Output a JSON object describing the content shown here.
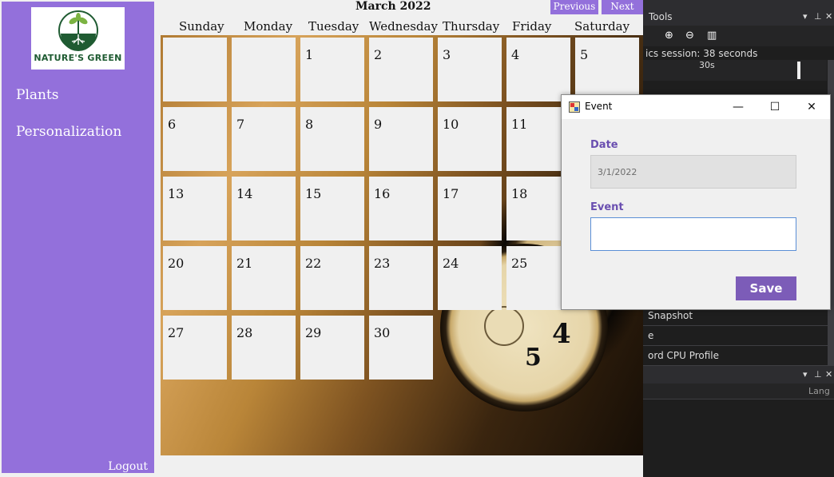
{
  "sidebar": {
    "logo_text": "NATURE'S GREEN",
    "nav_items": [
      {
        "label": "Plants"
      },
      {
        "label": "Personalization"
      }
    ],
    "logout_label": "Logout",
    "accent_color": "#9370db"
  },
  "calendar": {
    "month_title": "March 2022",
    "previous_label": "Previous",
    "next_label": "Next",
    "day_names": [
      "Sunday",
      "Monday",
      "Tuesday",
      "Wednesday",
      "Thursday",
      "Friday",
      "Saturday"
    ],
    "days": [
      "1",
      "2",
      "3",
      "4",
      "5",
      "6",
      "7",
      "8",
      "9",
      "10",
      "11",
      "13",
      "14",
      "15",
      "16",
      "17",
      "18",
      "20",
      "21",
      "22",
      "23",
      "24",
      "25",
      "27",
      "28",
      "29",
      "30"
    ],
    "clock_numbers": [
      "4",
      "5"
    ]
  },
  "dialog": {
    "title": "Event",
    "minimize_glyph": "—",
    "maximize_glyph": "☐",
    "close_glyph": "✕",
    "date_label": "Date",
    "date_value": "3/1/2022",
    "event_label": "Event",
    "event_value": "",
    "save_label": "Save"
  },
  "vs_panel": {
    "title": "Tools",
    "session_text": "ics session: 38 seconds",
    "timeline_tick": "30s",
    "list_items": [
      "Snapshot",
      "e",
      "ord CPU Profile"
    ],
    "column_header": "Lang"
  }
}
